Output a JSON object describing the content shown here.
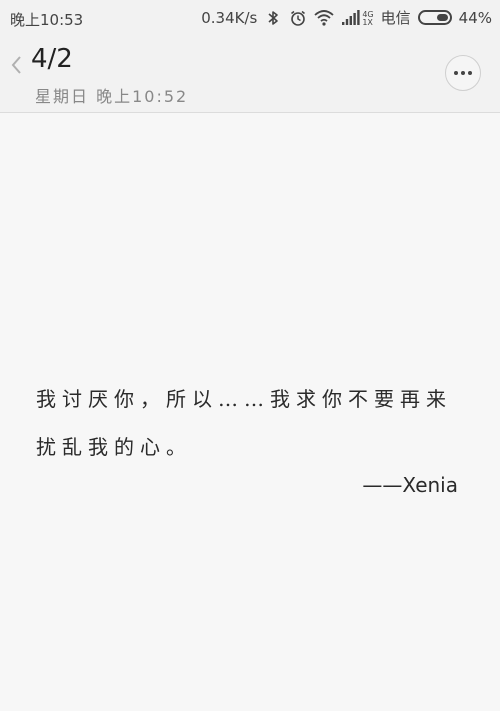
{
  "status_bar": {
    "time": "晚上10:53",
    "net_speed": "0.34K/s",
    "net_type_top": "4G",
    "net_type_bottom": "1X",
    "carrier": "电信",
    "battery_percent": "44%",
    "battery_level": 0.44,
    "icons": [
      "bluetooth-icon",
      "alarm-icon",
      "wifi-icon",
      "signal-icon"
    ]
  },
  "header": {
    "title": "4/2",
    "subtitle": "星期日 晚上10:52",
    "back_icon": "chevron-left-icon",
    "more_icon": "more-dots-icon"
  },
  "note": {
    "text": "我讨厌你，所以……我求你不要再来扰乱我的心。",
    "signature": "——Xenia"
  }
}
